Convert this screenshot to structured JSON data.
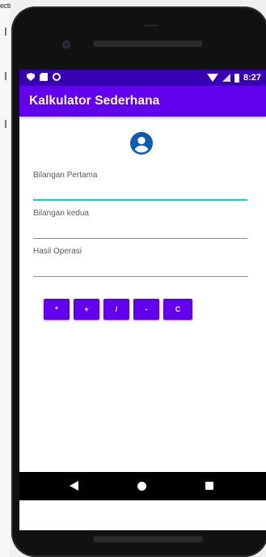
{
  "editor": {
    "fragment": "ecti"
  },
  "status_bar": {
    "time": "8:27"
  },
  "app_bar": {
    "title": "Kalkulator Sederhana"
  },
  "avatar": {
    "icon": "account-circle-icon",
    "color": "#0d5bb7"
  },
  "fields": [
    {
      "label": "Bilangan Pertama",
      "value": ""
    },
    {
      "label": "Bilangan kedua",
      "value": ""
    },
    {
      "label": "Hasil Operasi",
      "value": ""
    }
  ],
  "operators": [
    "*",
    "+",
    "/",
    "-",
    "C"
  ],
  "colors": {
    "primary": "#6200ee",
    "primary_dark": "#3700b3",
    "accent": "#03dac5",
    "avatar": "#0d5bb7"
  },
  "nav_bar": {
    "buttons": [
      "back",
      "home",
      "recents"
    ]
  }
}
